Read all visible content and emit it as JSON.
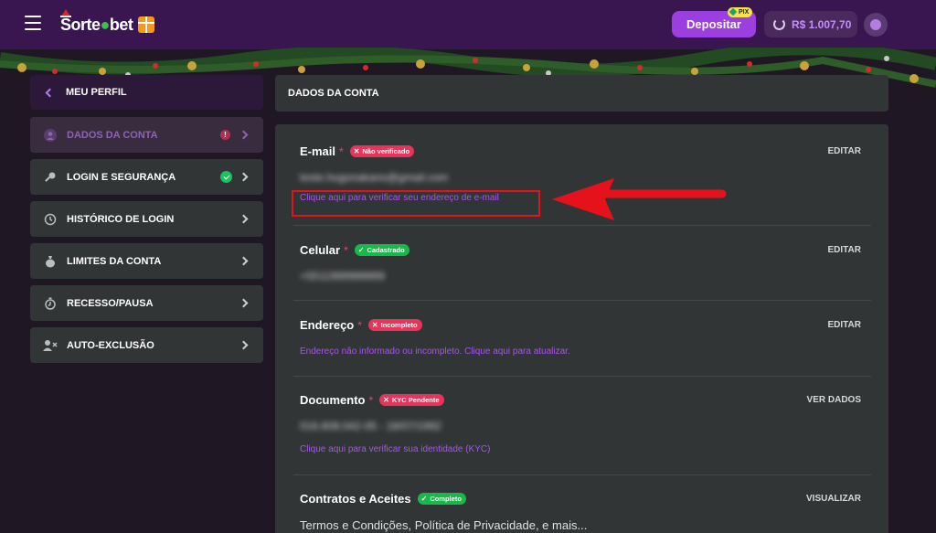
{
  "brand": {
    "logo_text": "SorteOnlineBet"
  },
  "topbar": {
    "deposit_label": "Depositar",
    "pix_badge": "PIX",
    "balance": "R$ 1.007,70"
  },
  "sidebar": {
    "header": "MEU PERFIL",
    "items": [
      {
        "label": "DADOS DA CONTA",
        "icon": "user-icon",
        "status": "warning",
        "status_text": "!"
      },
      {
        "label": "LOGIN E SEGURANÇA",
        "icon": "key-icon",
        "status": "ok"
      },
      {
        "label": "HISTÓRICO DE LOGIN",
        "icon": "history-icon"
      },
      {
        "label": "LIMITES DA CONTA",
        "icon": "money-bag-icon"
      },
      {
        "label": "RECESSO/PAUSA",
        "icon": "timer-icon"
      },
      {
        "label": "AUTO-EXCLUSÃO",
        "icon": "user-remove-icon"
      }
    ]
  },
  "main": {
    "header": "DADOS DA CONTA",
    "fields": {
      "email": {
        "label": "E-mail",
        "required_mark": "*",
        "badge": "Não verificado",
        "action": "EDITAR",
        "value": "teste.hugonakano@gmail.com",
        "link": "Clique aqui para verificar seu endereço de e-mail"
      },
      "phone": {
        "label": "Celular",
        "required_mark": "*",
        "badge": "Cadastrado",
        "action": "EDITAR",
        "value": "+5511999999999"
      },
      "address": {
        "label": "Endereço",
        "required_mark": "*",
        "badge": "Incompleto",
        "action": "EDITAR",
        "link": "Endereço não informado ou incompleto. Clique aqui para atualizar."
      },
      "document": {
        "label": "Documento",
        "required_mark": "*",
        "badge": "KYC Pendente",
        "action": "VER DADOS",
        "value": "016.608.042-05 - 18/07/1992",
        "link": "Clique aqui para verificar sua identidade (KYC)"
      },
      "contracts": {
        "label": "Contratos e Aceites",
        "badge": "Completo",
        "action": "VISUALIZAR",
        "value": "Termos e Condições, Política de Privacidade, e mais..."
      }
    }
  },
  "colors": {
    "topbar_bg": "#3a1650",
    "accent": "#9b3fe0",
    "link": "#a556e8",
    "badge_red": "#e8345a",
    "badge_green": "#18b84b",
    "highlight": "#e5121b"
  }
}
